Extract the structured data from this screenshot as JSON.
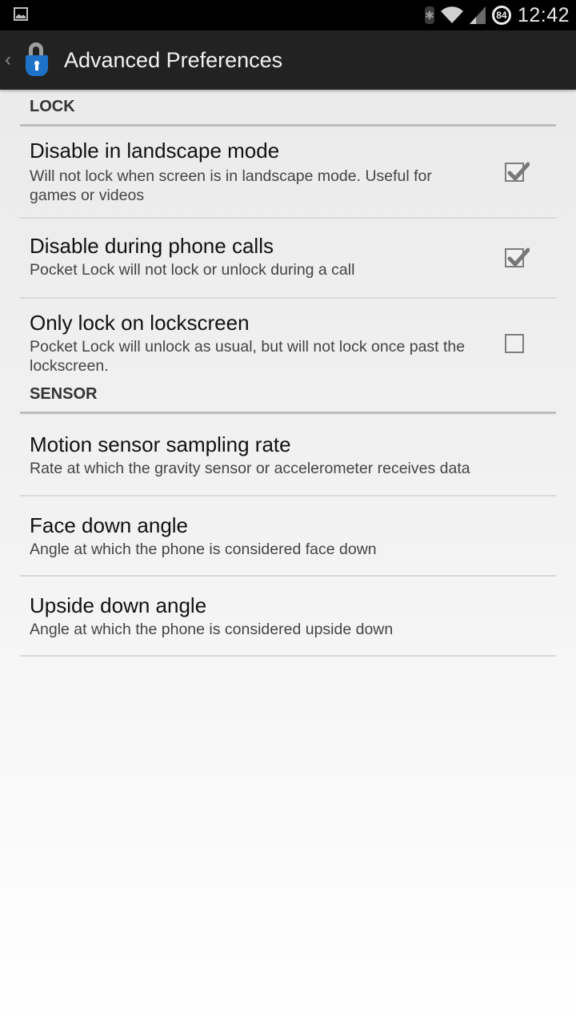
{
  "status_bar": {
    "notification_icon": "gallery-icon",
    "icons": [
      "bluetooth-icon",
      "wifi-icon",
      "signal-icon",
      "battery-icon"
    ],
    "battery_level": "84",
    "time": "12:42"
  },
  "action_bar": {
    "back_icon": "chevron-left-icon",
    "app_icon": "lock-icon",
    "title": "Advanced Preferences"
  },
  "categories": [
    {
      "title": "LOCK",
      "items": [
        {
          "title": "Disable in landscape mode",
          "summary": "Will not lock when screen is in landscape mode. Useful for games or videos",
          "checked": true
        },
        {
          "title": "Disable during phone calls",
          "summary": "Pocket Lock will not lock or unlock during a call",
          "checked": true
        },
        {
          "title": "Only lock on lockscreen",
          "summary": "Pocket Lock will unlock as usual, but will not lock once past the lockscreen.",
          "checked": false
        }
      ]
    },
    {
      "title": "SENSOR",
      "items": [
        {
          "title": "Motion sensor sampling rate",
          "summary": "Rate at which the gravity sensor or accelerometer receives data"
        },
        {
          "title": "Face down angle",
          "summary": "Angle at which the phone is considered face down"
        },
        {
          "title": "Upside down angle",
          "summary": "Angle at which the phone is considered upside down"
        }
      ]
    }
  ]
}
